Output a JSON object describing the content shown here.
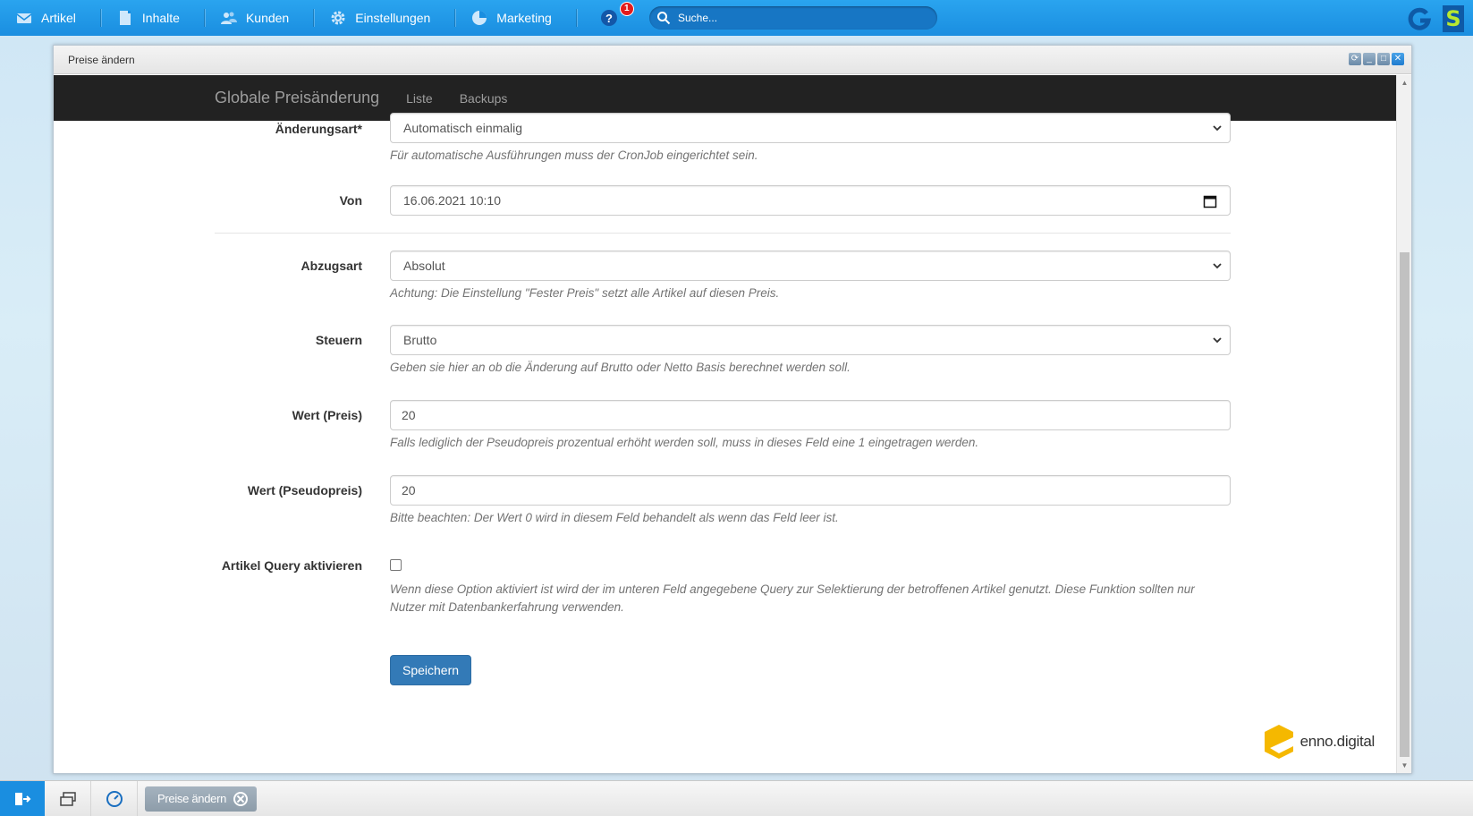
{
  "topbar": {
    "nav": [
      {
        "label": "Artikel",
        "icon": "envelope-icon"
      },
      {
        "label": "Inhalte",
        "icon": "document-icon"
      },
      {
        "label": "Kunden",
        "icon": "users-icon"
      },
      {
        "label": "Einstellungen",
        "icon": "gear-icon"
      },
      {
        "label": "Marketing",
        "icon": "pie-chart-icon"
      }
    ],
    "help_badge": "1",
    "search_placeholder": "Suche..."
  },
  "window": {
    "title": "Preise ändern"
  },
  "inner_nav": {
    "brand": "Globale Preisänderung",
    "links": [
      "Liste",
      "Backups"
    ]
  },
  "form": {
    "aenderungsart": {
      "label": "Änderungsart*",
      "value": "Automatisch einmalig",
      "help": "Für automatische Ausführungen muss der CronJob eingerichtet sein."
    },
    "von": {
      "label": "Von",
      "value": "16.06.2021 10:10"
    },
    "abzugsart": {
      "label": "Abzugsart",
      "value": "Absolut",
      "help": "Achtung: Die Einstellung \"Fester Preis\" setzt alle Artikel auf diesen Preis."
    },
    "steuern": {
      "label": "Steuern",
      "value": "Brutto",
      "help": "Geben sie hier an ob die Änderung auf Brutto oder Netto Basis berechnet werden soll."
    },
    "wert_preis": {
      "label": "Wert (Preis)",
      "value": "20",
      "help": "Falls lediglich der Pseudopreis prozentual erhöht werden soll, muss in dieses Feld eine 1 eingetragen werden."
    },
    "wert_pseudopreis": {
      "label": "Wert (Pseudopreis)",
      "value": "20",
      "help": "Bitte beachten: Der Wert 0 wird in diesem Feld behandelt als wenn das Feld leer ist."
    },
    "artikel_query": {
      "label": "Artikel Query aktivieren",
      "checked": false,
      "help": "Wenn diese Option aktiviert ist wird der im unteren Feld angegebene Query zur Selektierung der betroffenen Artikel genutzt. Diese Funktion sollten nur Nutzer mit Datenbankerfahrung verwenden."
    },
    "save_label": "Speichern"
  },
  "logo_text": "enno.digital",
  "taskbar": {
    "tab_label": "Preise ändern"
  },
  "colors": {
    "topbar": "#1a8ee0",
    "primary_button": "#337ab7",
    "inner_nav": "#222222"
  }
}
